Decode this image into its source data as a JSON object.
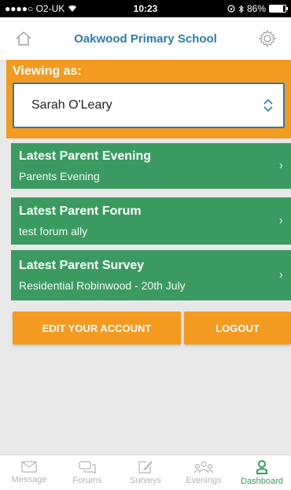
{
  "status_bar": {
    "carrier": "●●●●○ O2-UK",
    "time": "10:23",
    "battery": "86%",
    "battery_level": 0.86
  },
  "header": {
    "title": "Oakwood Primary School",
    "home_icon": "home-icon",
    "settings_icon": "gear-icon"
  },
  "viewing": {
    "label": "Viewing as:",
    "selected": "Sarah O'Leary"
  },
  "cards": [
    {
      "title": "Latest Parent Evening",
      "subtitle": "Parents Evening"
    },
    {
      "title": "Latest Parent Forum",
      "subtitle": "test forum ally"
    },
    {
      "title": "Latest Parent Survey",
      "subtitle": "Residential Robinwood - 20th July"
    }
  ],
  "buttons": {
    "edit_account": "EDIT YOUR ACCOUNT",
    "logout": "LOGOUT"
  },
  "tabs": [
    {
      "label": "Message",
      "icon": "envelope-icon"
    },
    {
      "label": "Forums",
      "icon": "chat-bubbles-icon"
    },
    {
      "label": "Surveys",
      "icon": "pencil-square-icon"
    },
    {
      "label": "Evenings",
      "icon": "group-icon"
    },
    {
      "label": "Dashboard",
      "icon": "person-icon",
      "active": true
    }
  ],
  "colors": {
    "orange": "#f39a21",
    "green": "#3a9a60",
    "blue": "#2b7ca8"
  }
}
